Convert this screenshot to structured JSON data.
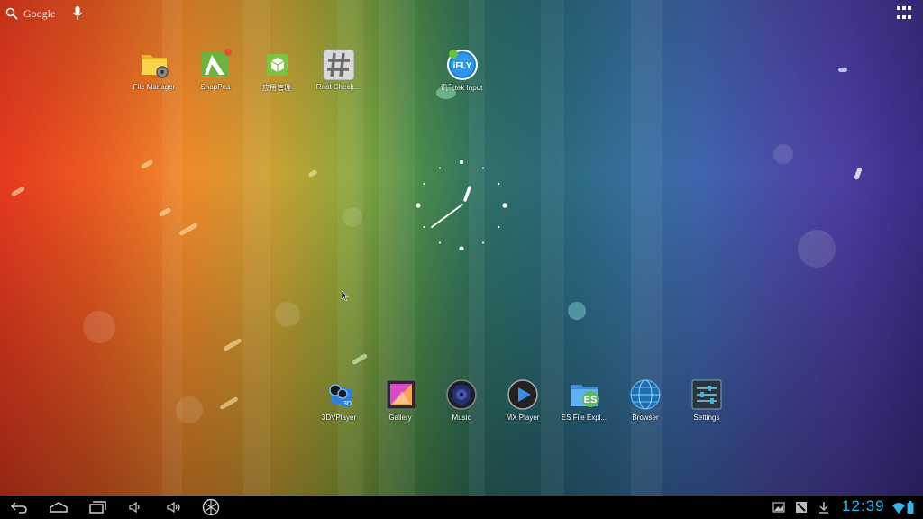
{
  "search": {
    "label": "Google"
  },
  "desktop_icons": [
    {
      "label": "File Manager"
    },
    {
      "label": "SnapPea"
    },
    {
      "label": "应用管理"
    },
    {
      "label": "Root Check..."
    },
    {
      "label": "讯飞tek Input"
    }
  ],
  "dock_icons": [
    {
      "label": "3DVPlayer"
    },
    {
      "label": "Gallery"
    },
    {
      "label": "Music"
    },
    {
      "label": "MX Player"
    },
    {
      "label": "ES File Expl..."
    },
    {
      "label": "Browser"
    },
    {
      "label": "Settings"
    }
  ],
  "status": {
    "time": "12:39"
  },
  "colors": {
    "clock_accent": "#33b5e5",
    "navbar": "#000000"
  }
}
